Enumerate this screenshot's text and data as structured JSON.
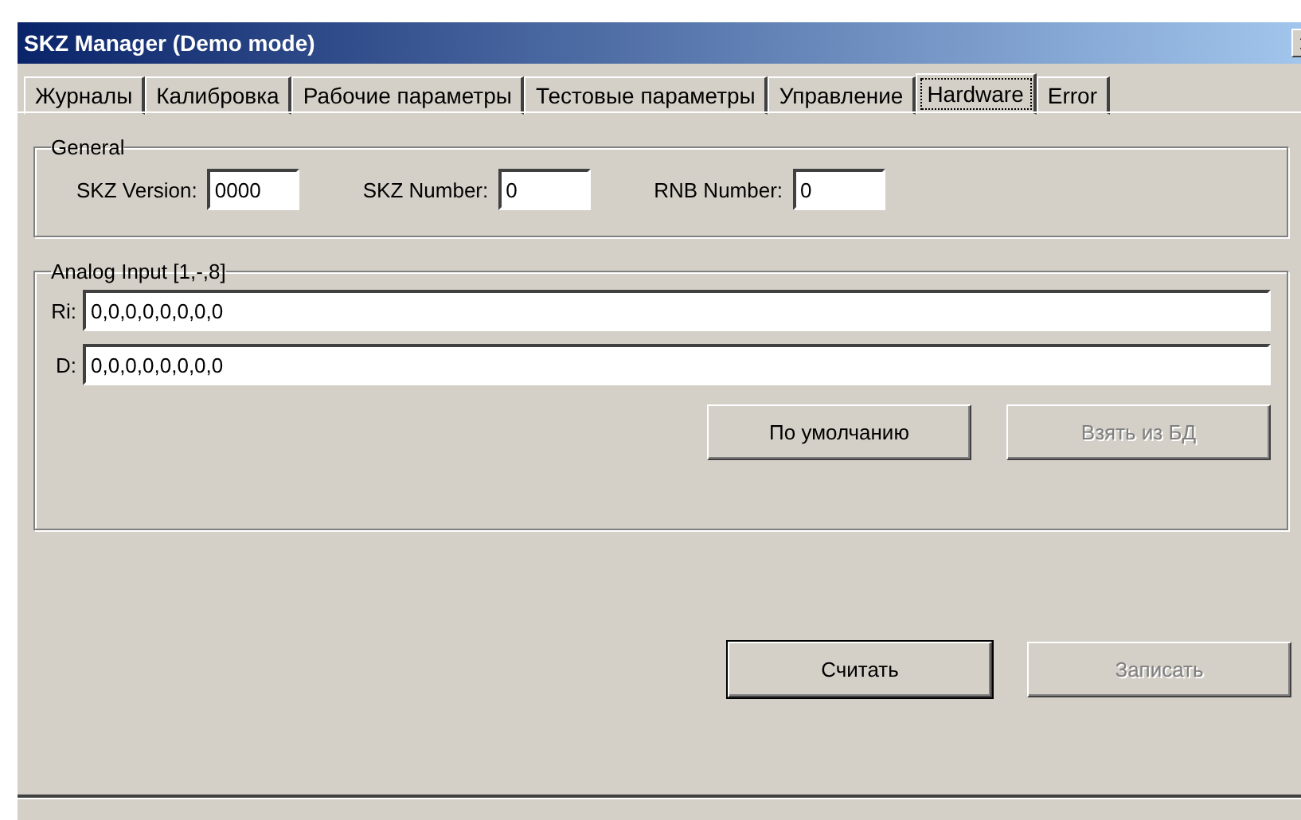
{
  "window": {
    "title": "SKZ Manager (Demo mode)"
  },
  "tabs": [
    {
      "label": "Журналы",
      "selected": false
    },
    {
      "label": "Калибровка",
      "selected": false
    },
    {
      "label": "Рабочие параметры",
      "selected": false
    },
    {
      "label": "Тестовые параметры",
      "selected": false
    },
    {
      "label": "Управление",
      "selected": false
    },
    {
      "label": "Hardware",
      "selected": true
    },
    {
      "label": "Error",
      "selected": false
    }
  ],
  "general": {
    "title": "General",
    "fields": [
      {
        "label": "SKZ Version:",
        "value": "0000"
      },
      {
        "label": "SKZ Number:",
        "value": "0"
      },
      {
        "label": "RNB Number:",
        "value": "0"
      }
    ]
  },
  "analog_input": {
    "title": "Analog Input [1,-,8]",
    "fields": [
      {
        "label": "Ri:",
        "value": "0,0,0,0,0,0,0,0"
      },
      {
        "label": "D:",
        "value": "0,0,0,0,0,0,0,0"
      }
    ],
    "buttons": [
      {
        "label": "По умолчанию",
        "disabled": false
      },
      {
        "label": "Взять из БД",
        "disabled": true
      }
    ]
  },
  "buttons": [
    {
      "label": "Считать",
      "disabled": false,
      "default": true
    },
    {
      "label": "Записать",
      "disabled": true,
      "default": false
    }
  ]
}
